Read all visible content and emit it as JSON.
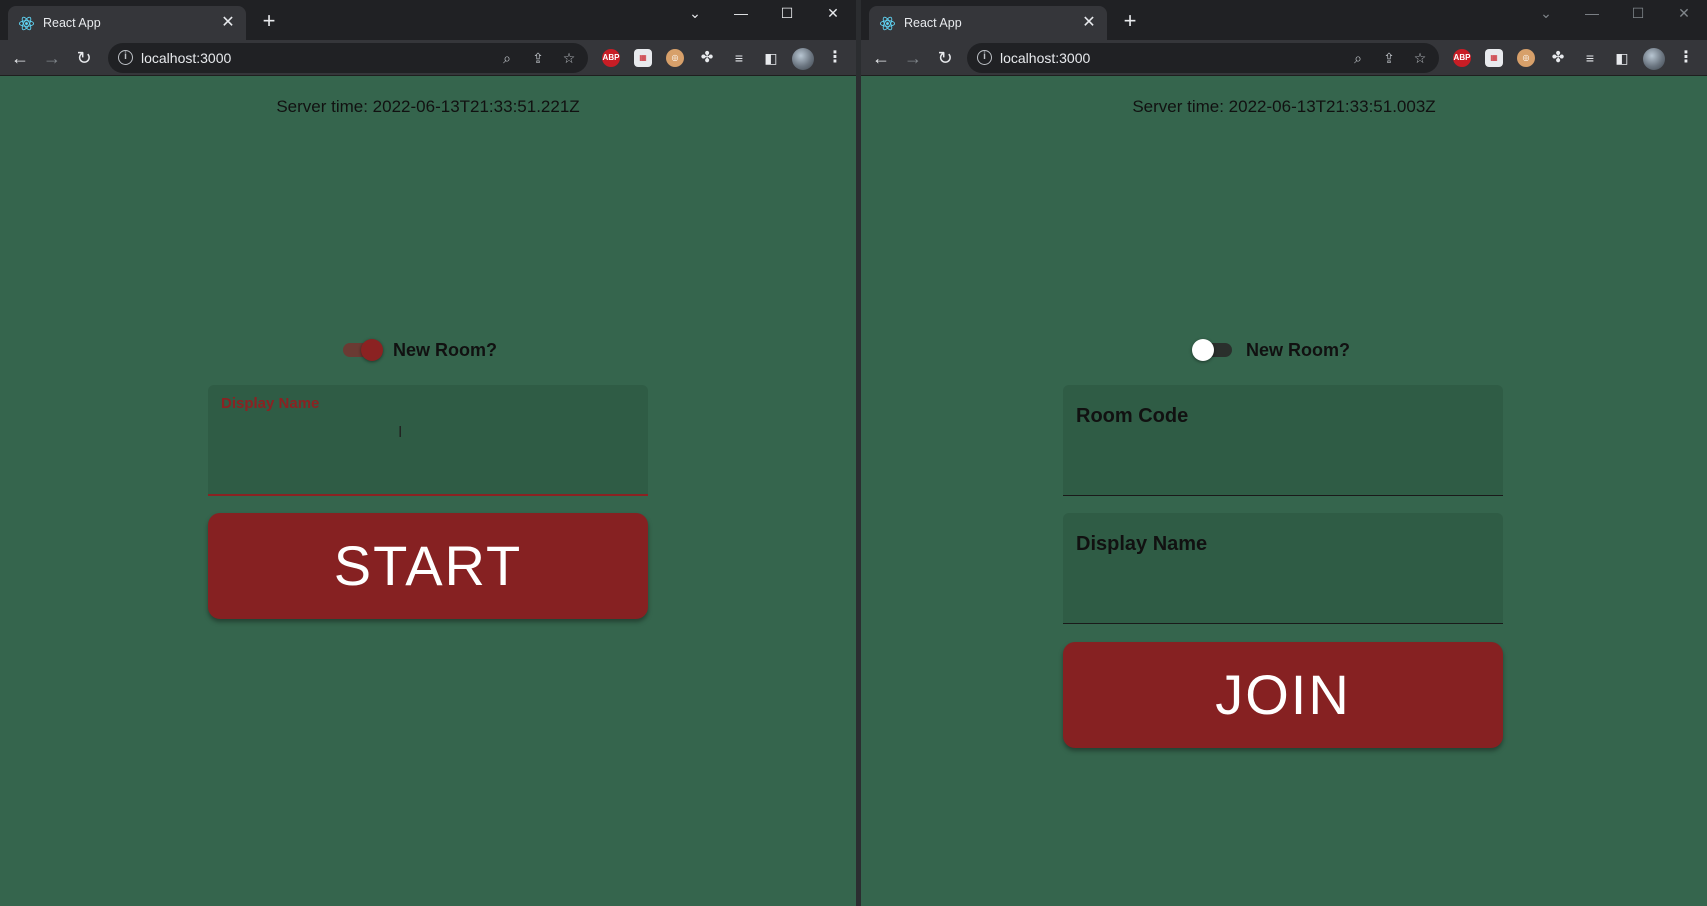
{
  "browser": {
    "tab_title": "React App",
    "url": "localhost:3000"
  },
  "left": {
    "server_time": "Server time: 2022-06-13T21:33:51.221Z",
    "switch_label": "New Room?",
    "switch_on": true,
    "display_name_label": "Display Name",
    "display_name_value": "",
    "start_button": "START"
  },
  "right": {
    "server_time": "Server time: 2022-06-13T21:33:51.003Z",
    "switch_label": "New Room?",
    "switch_on": false,
    "room_code_label": "Room Code",
    "room_code_value": "",
    "display_name_label": "Display Name",
    "display_name_value": "",
    "join_button": "JOIN"
  },
  "colors": {
    "page_bg": "#35654d",
    "accent_red": "#862122",
    "field_bg": "#2f5c45",
    "chrome_bg": "#202124",
    "toolbar_bg": "#35363a"
  },
  "extensions": {
    "adblock": "ABP"
  }
}
